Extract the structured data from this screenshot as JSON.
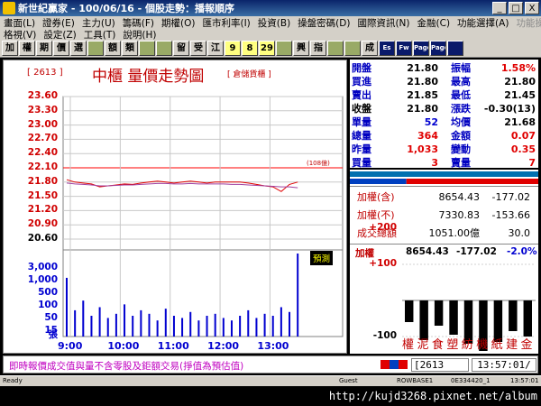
{
  "window": {
    "title": "新世紀贏家 - 100/06/16 - 個股走勢：播報順序",
    "buttons": [
      "_",
      "□",
      "X"
    ]
  },
  "menu1": [
    {
      "label": "畫面(L)",
      "enabled": true
    },
    {
      "label": "證券(E)",
      "enabled": true
    },
    {
      "label": "主力(U)",
      "enabled": true
    },
    {
      "label": "籌碼(F)",
      "enabled": true
    },
    {
      "label": "期權(O)",
      "enabled": true
    },
    {
      "label": "匯市利率(I)",
      "enabled": true
    },
    {
      "label": "投資(B)",
      "enabled": true
    },
    {
      "label": "操盤密碼(D)",
      "enabled": true
    },
    {
      "label": "國際資訊(N)",
      "enabled": true
    },
    {
      "label": "金融(C)",
      "enabled": true
    },
    {
      "label": "功能選擇(A)",
      "enabled": true
    },
    {
      "label": "功能操作(P)",
      "enabled": false
    }
  ],
  "menu2": [
    {
      "label": "格視(V)"
    },
    {
      "label": "設定(Z)"
    },
    {
      "label": "工具(T)"
    },
    {
      "label": "說明(H)"
    }
  ],
  "toolbar": [
    "加",
    "權",
    "期",
    "價",
    "選",
    "",
    "額",
    "類",
    "",
    "",
    "留",
    "受",
    "江",
    "9",
    "8",
    "29",
    "",
    "興",
    "指",
    "",
    "",
    "成",
    "Es",
    "Fw",
    "Page",
    "Page",
    ""
  ],
  "chart": {
    "code": "[ 2613 ]",
    "title": "中櫃  量價走勢圖",
    "tag": "[ 倉儲貨櫃 ]",
    "ref_label": "(108億)",
    "forecast": "預測",
    "volume_unit": "張"
  },
  "chart_data": {
    "type": "line",
    "xlabel": "",
    "ylabel": "",
    "x_ticks": [
      "9:00",
      "10:00",
      "11:00",
      "12:00",
      "13:00"
    ],
    "price_ticks": [
      "23.60",
      "23.30",
      "23.00",
      "22.70",
      "22.40",
      "22.10",
      "21.80",
      "21.50",
      "21.20",
      "20.90",
      "20.60"
    ],
    "price_ylim": [
      20.6,
      23.6
    ],
    "prev_close": 22.1,
    "volume_ticks": [
      "3,000",
      "1,000",
      "500",
      "100",
      "50",
      "15"
    ],
    "series": [
      {
        "name": "",
        "color": "#e00000",
        "values": [
          21.85,
          21.8,
          21.78,
          21.76,
          21.7,
          21.72,
          21.74,
          21.76,
          21.75,
          21.78,
          21.8,
          21.82,
          21.8,
          21.78,
          21.8,
          21.82,
          21.8,
          21.78,
          21.8,
          21.8,
          21.8,
          21.8,
          21.78,
          21.75,
          21.72,
          21.7,
          21.6,
          21.75,
          21.8
        ]
      },
      {
        "name": "",
        "color": "#a040a0",
        "values": [
          21.78,
          21.76,
          21.75,
          21.74,
          21.72,
          21.72,
          21.73,
          21.74,
          21.74,
          21.75,
          21.76,
          21.77,
          21.77,
          21.76,
          21.76,
          21.77,
          21.76,
          21.76,
          21.76,
          21.76,
          21.75,
          21.75,
          21.74,
          21.73,
          21.72,
          21.71,
          21.7,
          21.7,
          21.68
        ]
      }
    ],
    "volume": [
      40,
      8,
      15,
      5,
      10,
      4,
      6,
      12,
      5,
      8,
      6,
      3,
      9,
      5,
      4,
      7,
      3,
      5,
      6,
      4,
      3,
      5,
      8,
      4,
      6,
      5,
      10,
      7,
      80
    ]
  },
  "quote": {
    "rows": [
      {
        "l1": "開盤",
        "v1": "21.80",
        "c1": "black",
        "l2": "振幅",
        "v2": "1.58%",
        "c2": "red"
      },
      {
        "l1": "買進",
        "v1": "21.80",
        "c1": "black",
        "l2": "最高",
        "v2": "21.80",
        "c2": "black"
      },
      {
        "l1": "賣出",
        "v1": "21.85",
        "c1": "black",
        "l2": "最低",
        "v2": "21.45",
        "c2": "black"
      },
      {
        "l1": "收盤",
        "v1": "21.80",
        "c1": "black",
        "l2": "漲跌",
        "v2": "-0.30(13)",
        "c2": "black"
      },
      {
        "l1": "單量",
        "v1": "52",
        "c1": "blue",
        "l2": "均價",
        "v2": "21.68",
        "c2": "black"
      },
      {
        "l1": "總量",
        "v1": "364",
        "c1": "red",
        "l2": "金額",
        "v2": "0.07",
        "c2": "red"
      },
      {
        "l1": "昨量",
        "v1": "1,033",
        "c1": "red",
        "l2": "變動",
        "v2": "0.35",
        "c2": "red"
      },
      {
        "l1": "買量",
        "v1": "3",
        "c1": "red",
        "l2": "賣量",
        "v2": "7",
        "c2": "red"
      }
    ],
    "buy_ratio": 0.3
  },
  "index": [
    {
      "label": "加權(含)",
      "v1": "8654.43",
      "v2": "-177.02"
    },
    {
      "label": "加權(不)",
      "v1": "7330.83",
      "v2": "-153.66"
    },
    {
      "label": "成交總額",
      "v1": "1051.00億",
      "v2": "30.0"
    }
  ],
  "sector": {
    "head_label": "加權",
    "head_v1": "8654.43",
    "head_v2": "-177.02",
    "head_pct": "-2.0%",
    "ticks_up": [
      "+200",
      "+100"
    ],
    "ticks_dn": [
      "-100",
      "-200"
    ],
    "names": [
      "權",
      "泥",
      "食",
      "塑",
      "紡",
      "機",
      "紙",
      "建",
      "金"
    ],
    "values": [
      -60,
      -110,
      -70,
      -95,
      -120,
      -140,
      -115,
      -85,
      -100
    ]
  },
  "footer": {
    "disclaimer": "即時報價成交值與量不含零股及鉅額交易(掙值為預估值)",
    "code": "[2613",
    "clock": "13:57:01/"
  },
  "status": {
    "ready": "Ready",
    "guest": "Guest",
    "server": "ROWBASE1",
    "id": "0E334420_1",
    "time": "13:57:01"
  },
  "watermark_url": "http://kujd3268.pixnet.net/album"
}
